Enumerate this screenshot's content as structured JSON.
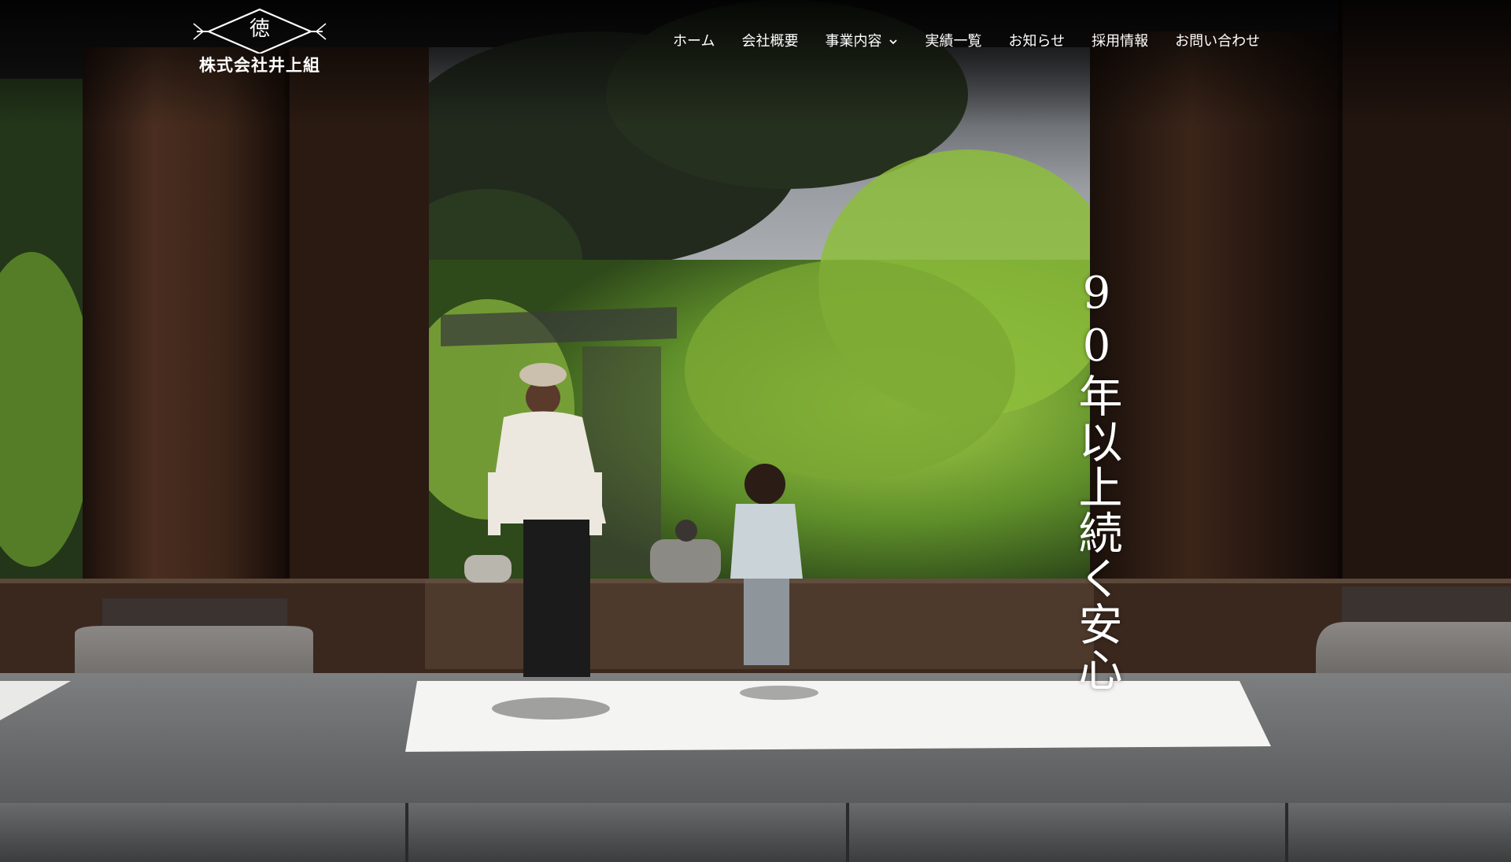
{
  "site": {
    "logo_mark": "徳",
    "company_name": "株式会社井上組"
  },
  "nav": {
    "items": [
      {
        "label": "ホーム",
        "has_dropdown": false
      },
      {
        "label": "会社概要",
        "has_dropdown": false
      },
      {
        "label": "事業内容",
        "has_dropdown": true
      },
      {
        "label": "実績一覧",
        "has_dropdown": false
      },
      {
        "label": "お知らせ",
        "has_dropdown": false
      },
      {
        "label": "採用情報",
        "has_dropdown": false
      },
      {
        "label": "お問い合わせ",
        "has_dropdown": false
      }
    ]
  },
  "hero": {
    "tagline": "90年以上続く安心",
    "image_scene": "temple-gate-photo"
  },
  "colors": {
    "header_text": "#ffffff",
    "tagline_text": "#ffffff",
    "wood_dark": "#2a1a12",
    "foliage_green": "#6f9a2e"
  }
}
